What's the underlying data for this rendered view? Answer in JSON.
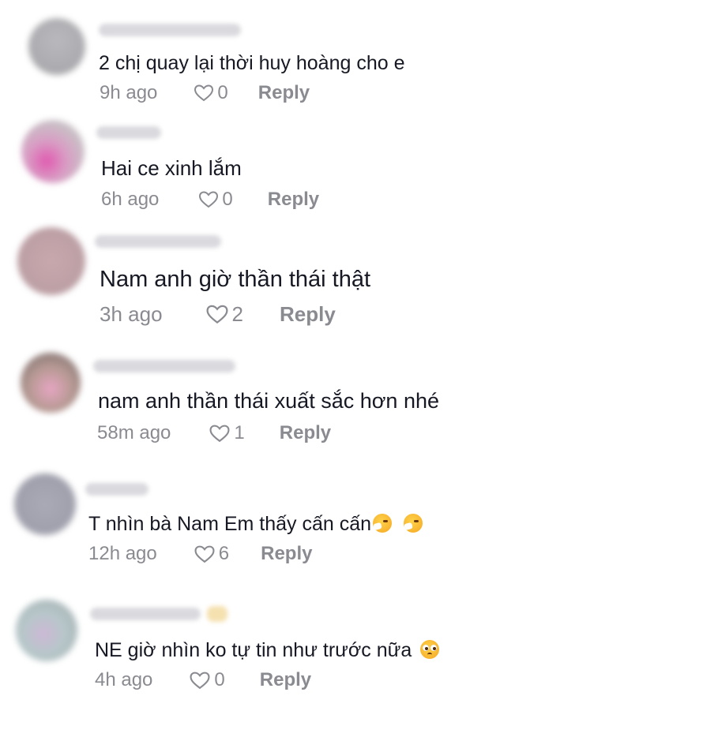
{
  "comments": [
    {
      "text": "2 chị quay lại thời huy hoàng cho e",
      "time": "9h ago",
      "likes": "0",
      "reply": "Reply",
      "emoji": []
    },
    {
      "text": "Hai ce xinh lắm",
      "time": "6h ago",
      "likes": "0",
      "reply": "Reply",
      "emoji": []
    },
    {
      "text": "Nam anh giờ thần thái thật",
      "time": "3h ago",
      "likes": "2",
      "reply": "Reply",
      "emoji": []
    },
    {
      "text": "nam anh thần thái xuất sắc hơn nhé",
      "time": "58m ago",
      "likes": "1",
      "reply": "Reply",
      "emoji": []
    },
    {
      "text": "T nhìn bà Nam Em thấy cấn cấn",
      "time": "12h ago",
      "likes": "6",
      "reply": "Reply",
      "emoji": [
        "sneezing-face",
        "sneezing-face"
      ]
    },
    {
      "text": "NE giờ nhìn ko tự tin như trước nữa",
      "time": "4h ago",
      "likes": "0",
      "reply": "Reply",
      "emoji": [
        "pleading-face"
      ]
    }
  ],
  "colors": {
    "text": "#161823",
    "meta": "#8a8b91",
    "background": "#ffffff"
  }
}
